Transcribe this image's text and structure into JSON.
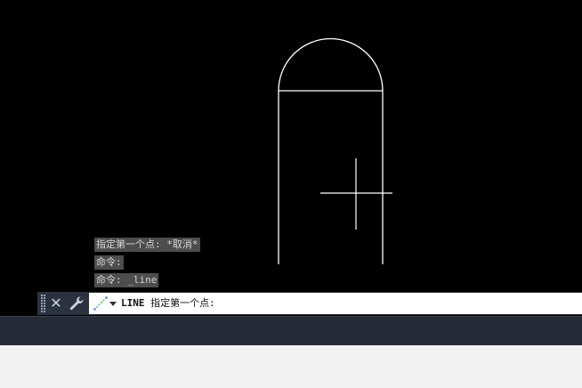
{
  "history": {
    "lines": [
      "指定第一个点: *取消*",
      "命令:",
      "命令: _line"
    ]
  },
  "command_bar": {
    "keyword": "LINE",
    "prompt": " 指定第一个点:"
  },
  "colors": {
    "canvas_background": "#000000",
    "drawing_lines": "#ffffff",
    "command_bar": "#2c3340",
    "history_background": "#4d4d4d",
    "history_text": "#d8d8d8",
    "status_bar": "#262c37",
    "bottom_area": "#f2f2f2"
  },
  "icons": {
    "grip": "grip-icon",
    "close": "close-icon",
    "customize": "wrench-icon",
    "command": "line-command-icon",
    "dropdown": "caret-down-icon"
  }
}
